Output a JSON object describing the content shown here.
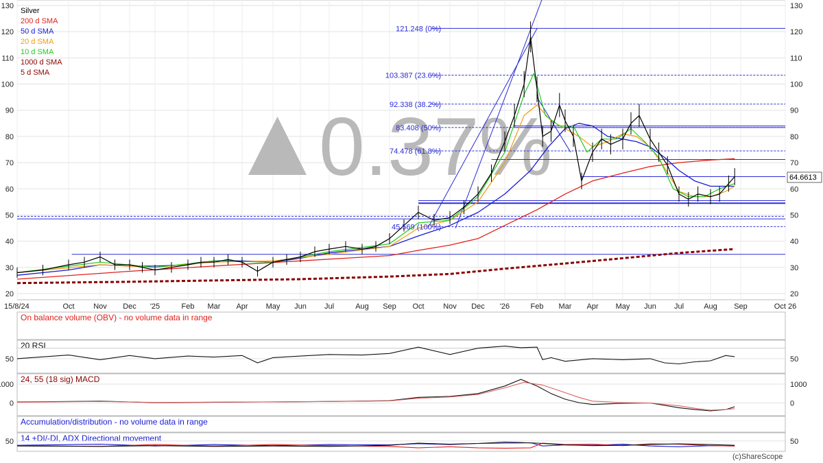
{
  "app": {
    "credit": "(c)ShareScope",
    "watermark": "0.37%",
    "watermark_icon": "up-triangle-icon"
  },
  "colors": {
    "sma200": "#e0201a",
    "sma50": "#1a1ad6",
    "sma20": "#f39b0c",
    "sma10": "#1ecc1e",
    "sma1000": "#8b0000",
    "sma5": "#8b0000",
    "candle": "#000000",
    "trend": "#2b2bd6",
    "rsi_fill": "#e06060",
    "macd_signal": "#e06060"
  },
  "chart_data": [
    {
      "type": "line",
      "name": "price-panel",
      "title": "Silver",
      "x_labels": [
        "15/8/24",
        "Oct",
        "Nov",
        "Dec",
        "'25",
        "Feb",
        "Mar",
        "Apr",
        "May",
        "Jun",
        "Jul",
        "Aug",
        "Sep",
        "Oct",
        "Nov",
        "Dec",
        "'26",
        "Feb",
        "Mar",
        "Apr",
        "May",
        "Jun",
        "Jul",
        "Aug",
        "Sep",
        "Oct 26"
      ],
      "x_range_months": [
        0,
        26.3
      ],
      "ylim": [
        17,
        130
      ],
      "yticks": [
        20,
        30,
        40,
        50,
        60,
        70,
        80,
        90,
        100,
        110,
        120,
        130
      ],
      "last_price": "64.6613",
      "legend": [
        {
          "label": "Silver",
          "color": "#000000"
        },
        {
          "label": "200 d  SMA",
          "color": "#e0201a"
        },
        {
          "label": "50 d  SMA",
          "color": "#1a1ad6"
        },
        {
          "label": "20 d  SMA",
          "color": "#f39b0c"
        },
        {
          "label": "10 d  SMA",
          "color": "#1ecc1e"
        },
        {
          "label": "1000 d  SMA",
          "color": "#8b0000"
        },
        {
          "label": "5 d  SMA",
          "color": "#8b0000"
        }
      ],
      "fibonacci": [
        {
          "label": "121.248 (0%)",
          "value": 121.248
        },
        {
          "label": "103.387 (23.6%)",
          "value": 103.387
        },
        {
          "label": "92.338 (38.2%)",
          "value": 92.338
        },
        {
          "label": "83.408 (50%)",
          "value": 83.408
        },
        {
          "label": "74.478 (61.8%)",
          "value": 74.478
        },
        {
          "label": "45.569 (100%)",
          "value": 45.569
        }
      ],
      "series": [
        {
          "name": "Silver",
          "x": [
            0,
            0.5,
            1,
            1.5,
            2,
            2.5,
            3,
            3.5,
            4,
            4.5,
            5,
            5.5,
            6,
            6.5,
            7,
            7.5,
            8,
            8.5,
            9,
            9.5,
            10,
            10.5,
            11,
            11.5,
            12,
            12.5,
            13,
            13.5,
            14,
            14.5,
            15,
            15.5,
            16,
            16.3,
            16.6,
            16.8,
            17,
            17.2,
            17.5,
            17.8,
            18,
            18.3,
            18.6,
            19,
            19.3,
            19.6,
            20,
            20.3,
            20.6,
            21,
            21.3,
            21.6,
            22,
            22.3,
            22.6,
            23,
            23.3,
            23.6,
            23.8
          ],
          "values": [
            28,
            29,
            31,
            32,
            34,
            31,
            31,
            30,
            29,
            30,
            31,
            32,
            32,
            33,
            32,
            28.5,
            32,
            33,
            34,
            36,
            37,
            38,
            37,
            38,
            41,
            46,
            51,
            48,
            49,
            53,
            58,
            66,
            78,
            88,
            100,
            118,
            98,
            80,
            82,
            92,
            86,
            80,
            63,
            74,
            79,
            77,
            79,
            85,
            88,
            79,
            74,
            69,
            58,
            56,
            58,
            57,
            58,
            62,
            64.66
          ]
        },
        {
          "name": "200 d  SMA",
          "x": [
            0,
            3,
            6,
            9,
            12,
            13,
            14,
            15,
            16,
            17,
            18,
            19,
            20,
            21,
            22,
            23,
            23.8
          ],
          "values": [
            25.5,
            28.5,
            30.5,
            32.5,
            34.5,
            36.5,
            38.5,
            41,
            46,
            52,
            58,
            63,
            66,
            68.5,
            70,
            71,
            71.5
          ]
        },
        {
          "name": "50 d  SMA",
          "x": [
            0,
            1,
            2,
            3,
            4,
            5,
            6,
            7,
            8,
            9,
            10,
            11,
            12,
            13,
            14,
            15,
            16,
            16.8,
            17.4,
            18,
            18.5,
            19,
            19.5,
            20,
            20.5,
            21,
            21.5,
            22,
            22.5,
            23,
            23.5,
            23.8
          ],
          "values": [
            27,
            29,
            31,
            30.5,
            30.5,
            31,
            32.5,
            32.5,
            32,
            33.5,
            35.5,
            37,
            38,
            42,
            46,
            51,
            58,
            67,
            76,
            83,
            85,
            84,
            80,
            79,
            78,
            76,
            72,
            67,
            63,
            61,
            61,
            61
          ]
        },
        {
          "name": "20 d  SMA",
          "x": [
            0,
            2,
            4,
            6,
            8,
            10,
            12,
            13,
            14,
            15,
            16,
            16.6,
            17,
            17.5,
            18,
            18.5,
            19,
            19.5,
            20,
            20.5,
            21,
            21.5,
            22,
            22.5,
            23,
            23.5,
            23.8
          ],
          "values": [
            28,
            31,
            30,
            32,
            32.5,
            35,
            38,
            45,
            48,
            55,
            70,
            88,
            92,
            86,
            83,
            80,
            76,
            78,
            81,
            80,
            76,
            68,
            59,
            57,
            57,
            59,
            61
          ]
        },
        {
          "name": "10 d  SMA",
          "x": [
            0,
            2,
            4,
            6,
            8,
            10,
            12,
            13,
            14,
            15,
            16,
            16.6,
            16.9,
            17.3,
            17.8,
            18.3,
            18.8,
            19.3,
            19.8,
            20.3,
            20.8,
            21.3,
            21.8,
            22.3,
            22.8,
            23.3,
            23.8
          ],
          "values": [
            28,
            32,
            30,
            32.5,
            32,
            36,
            39,
            47,
            48,
            57,
            74,
            96,
            104,
            88,
            84,
            84,
            74,
            79,
            79,
            83,
            78,
            72,
            60,
            57,
            57,
            60,
            62
          ]
        },
        {
          "name": "1000 d  SMA",
          "x": [
            0,
            3,
            6,
            9,
            12,
            14,
            16,
            18,
            20,
            22,
            23.8
          ],
          "values": [
            24,
            24.5,
            25,
            25.5,
            26.5,
            27.5,
            29.5,
            31.5,
            33.5,
            35.5,
            37
          ]
        }
      ],
      "trendlines": [
        {
          "from": [
            14.2,
            45
          ],
          "to": [
            17.2,
            133
          ]
        },
        {
          "from": [
            13.3,
            45
          ],
          "to": [
            17.0,
            121.2
          ]
        },
        {
          "from": [
            17.0,
            95
          ],
          "to": [
            18.2,
            74
          ]
        }
      ],
      "horizontal_levels": [
        35,
        48.5,
        54.5,
        55.5,
        64.66,
        71.2,
        83.4,
        84
      ]
    },
    {
      "type": "line",
      "name": "obv-panel",
      "title": "On balance volume (OBV) - no volume data in range"
    },
    {
      "type": "line",
      "name": "rsi-panel",
      "title": "20 RSI",
      "ylim": [
        25,
        80
      ],
      "yticks": [
        50
      ],
      "series": [
        {
          "name": "RSI",
          "x": [
            0,
            1,
            2,
            3,
            4,
            5,
            6,
            7,
            7.5,
            8,
            9,
            10,
            11,
            12,
            13,
            14,
            15,
            16,
            16.5,
            17,
            17.2,
            17.5,
            18,
            19,
            20,
            21,
            21.5,
            22,
            22.5,
            23,
            23.5,
            23.8
          ],
          "values": [
            50,
            57,
            48,
            56,
            50,
            55,
            53,
            56,
            42,
            52,
            55,
            58,
            57,
            60,
            72,
            58,
            70,
            74,
            71,
            72,
            48,
            52,
            45,
            50,
            48,
            50,
            42,
            40,
            44,
            46,
            56,
            54
          ]
        }
      ]
    },
    {
      "type": "line",
      "name": "macd-panel",
      "title": "24, 55 (18 sig) MACD",
      "ylim": [
        -600,
        1400
      ],
      "yticks": [
        0,
        1000
      ],
      "series": [
        {
          "name": "MACD",
          "x": [
            0,
            2,
            4,
            6,
            8,
            10,
            12,
            13,
            14,
            15,
            16,
            16.5,
            17,
            17.5,
            18,
            18.5,
            19,
            20,
            21,
            22,
            22.5,
            23,
            23.5,
            23.8
          ],
          "values": [
            50,
            100,
            20,
            40,
            60,
            80,
            120,
            300,
            350,
            500,
            900,
            1250,
            900,
            500,
            200,
            20,
            -80,
            -20,
            0,
            -250,
            -350,
            -420,
            -350,
            -200
          ]
        },
        {
          "name": "Signal",
          "x": [
            0,
            2,
            4,
            6,
            8,
            10,
            12,
            13,
            14,
            15,
            16,
            16.6,
            17.2,
            17.8,
            18.5,
            19,
            20,
            21,
            22,
            22.5,
            23,
            23.5,
            23.8
          ],
          "values": [
            40,
            80,
            30,
            45,
            60,
            80,
            110,
            250,
            320,
            450,
            800,
            1100,
            950,
            650,
            300,
            100,
            20,
            0,
            -150,
            -280,
            -380,
            -340,
            -300
          ]
        }
      ]
    },
    {
      "type": "line",
      "name": "acc-dist-panel",
      "title": "Accumulation/distribution - no volume data in range"
    },
    {
      "type": "line",
      "name": "dmi-panel",
      "title": "14 +DI/-DI, ADX Directional movement",
      "ylim": [
        0,
        80
      ],
      "yticks": [
        50
      ],
      "series": [
        {
          "name": "+DI",
          "x": [
            0,
            2,
            4,
            6,
            8,
            10,
            12,
            13,
            14,
            15,
            16,
            16.8,
            17.2,
            18,
            19,
            20,
            21,
            22,
            23,
            23.8
          ],
          "values": [
            26,
            32,
            22,
            30,
            24,
            30,
            28,
            35,
            30,
            36,
            38,
            40,
            22,
            28,
            26,
            32,
            22,
            18,
            24,
            22
          ]
        },
        {
          "name": "-DI",
          "x": [
            0,
            2,
            4,
            6,
            8,
            10,
            12,
            13,
            14,
            15,
            16,
            16.8,
            17.2,
            18,
            19,
            20,
            21,
            22,
            23,
            23.8
          ],
          "values": [
            24,
            20,
            30,
            22,
            30,
            24,
            20,
            12,
            18,
            12,
            10,
            12,
            38,
            30,
            32,
            24,
            34,
            32,
            24,
            22
          ]
        },
        {
          "name": "ADX",
          "x": [
            0,
            2,
            4,
            6,
            8,
            10,
            12,
            13,
            14,
            15,
            16,
            17,
            18,
            19,
            20,
            21,
            22,
            23,
            23.8
          ],
          "values": [
            22,
            20,
            24,
            20,
            22,
            20,
            26,
            38,
            32,
            36,
            44,
            38,
            28,
            24,
            26,
            30,
            34,
            30,
            26
          ]
        }
      ]
    }
  ]
}
